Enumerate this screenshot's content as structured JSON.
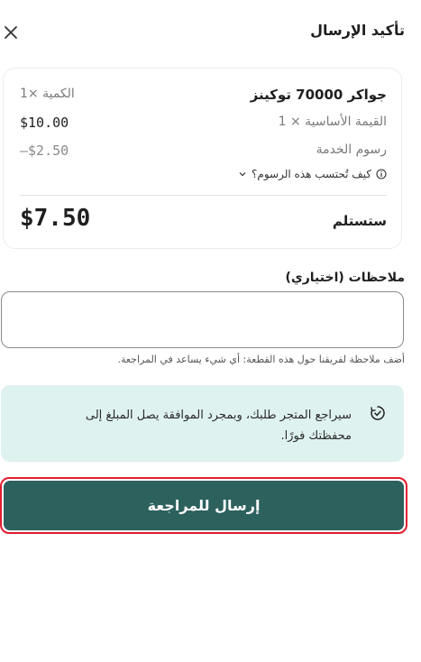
{
  "header": {
    "title": "تأكيد الإرسال",
    "close_icon": "close-icon"
  },
  "summary": {
    "product_name": "جواكر 70000 توكينز",
    "quantity": "الكمية ×1",
    "base_value_label": "القيمة الأساسية × 1",
    "base_value": "$10.00",
    "service_fee_label": "رسوم الخدمة",
    "service_fee": "–$2.50",
    "fee_info_link": "كيف تُحتسب هذه الرسوم؟",
    "receive_label": "ستستلم",
    "receive_amount": "$7.50"
  },
  "notes": {
    "label": "ملاحظات (اختياري)",
    "value": "",
    "placeholder": "",
    "helper": "أضف ملاحظة لفريقنا حول هذه القطعة: أي شيء يساعد في المراجعة."
  },
  "info": {
    "icon": "clock-check-icon",
    "text": "سيراجع المتجر طلبك، وبمجرد الموافقة يصل المبلغ إلى محفظتك فورًا."
  },
  "actions": {
    "submit_label": "إرسال للمراجعة"
  },
  "colors": {
    "primary": "#2c615e",
    "info_bg": "#def2f0",
    "highlight_border": "#e11d2e"
  }
}
